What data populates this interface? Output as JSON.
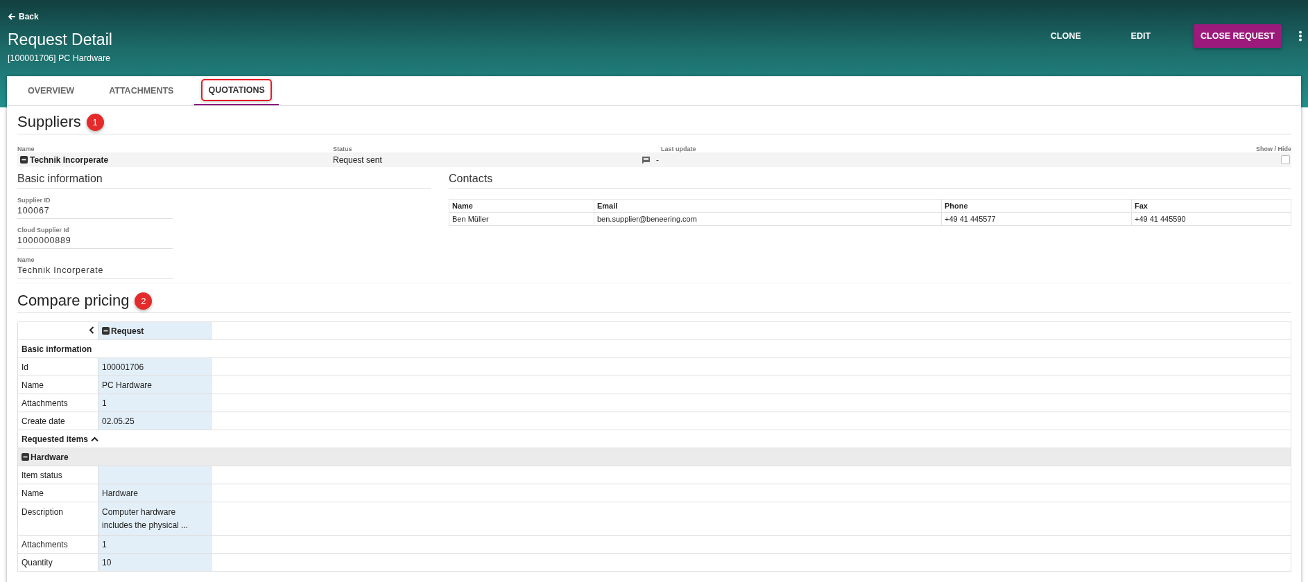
{
  "header": {
    "back_label": "Back",
    "title": "Request Detail",
    "subtitle": "[100001706] PC Hardware",
    "actions": [
      {
        "label": "CLONE",
        "kind": "text"
      },
      {
        "label": "EDIT",
        "kind": "text"
      },
      {
        "label": "CLOSE REQUEST",
        "kind": "primary"
      }
    ]
  },
  "tabs": [
    {
      "label": "OVERVIEW",
      "selected": false
    },
    {
      "label": "ATTACHMENTS",
      "selected": false
    },
    {
      "label": "QUOTATIONS",
      "selected": true,
      "highlighted": true
    }
  ],
  "suppliers": {
    "title": "Suppliers",
    "badge": "1",
    "columns": {
      "name": "Name",
      "status": "Status",
      "last_update": "Last update",
      "show_hide": "Show / Hide"
    },
    "rows": [
      {
        "name": "Technik Incorperate",
        "status": "Request sent",
        "last_update": "-",
        "expanded": true,
        "visible": false
      }
    ],
    "basic_information": {
      "title": "Basic information",
      "fields": [
        {
          "label": "Supplier ID",
          "value": "100067"
        },
        {
          "label": "Cloud Supplier Id",
          "value": "1000000889"
        },
        {
          "label": "Name",
          "value": "Technik Incorperate"
        }
      ]
    },
    "contacts": {
      "title": "Contacts",
      "columns": [
        "Name",
        "Email",
        "Phone",
        "Fax"
      ],
      "rows": [
        [
          "Ben Müller",
          "ben.supplier@beneering.com",
          "+49 41 445577",
          "+49 41 445590"
        ]
      ]
    }
  },
  "compare_pricing": {
    "title": "Compare pricing",
    "badge": "2",
    "column_header": "Request",
    "column_expanded": true,
    "rows": [
      {
        "kind": "section",
        "label": "Basic information"
      },
      {
        "kind": "field",
        "label": "Id",
        "value": "100001706"
      },
      {
        "kind": "field",
        "label": "Name",
        "value": "PC Hardware"
      },
      {
        "kind": "field",
        "label": "Attachments",
        "value": "1"
      },
      {
        "kind": "field",
        "label": "Create date",
        "value": "02.05.25"
      },
      {
        "kind": "section",
        "label": "Requested items",
        "expanded": true
      },
      {
        "kind": "group",
        "label": "Hardware",
        "expanded": true
      },
      {
        "kind": "field",
        "label": "Item status"
      },
      {
        "kind": "field",
        "label": "Name",
        "value": "Hardware"
      },
      {
        "kind": "field",
        "label": "Description",
        "value": "Computer hardware includes the physical ..."
      },
      {
        "kind": "field",
        "label": "Attachments",
        "value": "1"
      },
      {
        "kind": "field",
        "label": "Quantity",
        "value": "10"
      }
    ]
  }
}
